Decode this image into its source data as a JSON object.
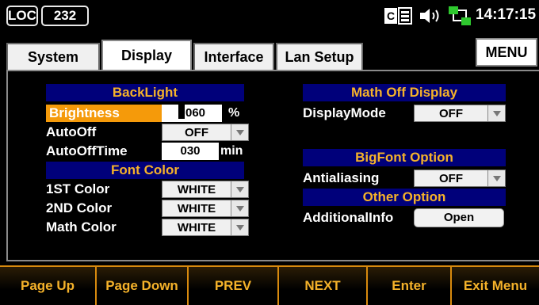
{
  "status": {
    "loc": "LOC",
    "interface": "232",
    "clock": "14:17:15"
  },
  "tabs": {
    "system": "System",
    "display": "Display",
    "interface": "Interface",
    "lan": "Lan Setup",
    "menu": "MENU"
  },
  "backlight": {
    "header": "BackLight",
    "brightness_label": "Brightness",
    "brightness_value": "060",
    "brightness_unit": "%",
    "autooff_label": "AutoOff",
    "autooff_value": "OFF",
    "autoofftime_label": "AutoOffTime",
    "autoofftime_value": "030",
    "autoofftime_unit": "min"
  },
  "fontcolor": {
    "header": "Font Color",
    "first_label": "1ST Color",
    "first_value": "WHITE",
    "second_label": "2ND Color",
    "second_value": "WHITE",
    "math_label": "Math Color",
    "math_value": "WHITE"
  },
  "mathoff": {
    "header": "Math Off Display",
    "mode_label": "DisplayMode",
    "mode_value": "OFF"
  },
  "bigfont": {
    "header": "BigFont Option",
    "aa_label": "Antialiasing",
    "aa_value": "OFF"
  },
  "other": {
    "header": "Other Option",
    "info_label": "AdditionalInfo",
    "info_button": "Open"
  },
  "softkeys": {
    "k1": "Page Up",
    "k2": "Page Down",
    "k3": "PREV",
    "k4": "NEXT",
    "k5": "Enter",
    "k6": "Exit Menu"
  },
  "colors": {
    "header_bg": "#00007a",
    "header_text": "#f5b22a",
    "highlight": "#f59a0a",
    "softkey_text": "#f5b22a"
  }
}
